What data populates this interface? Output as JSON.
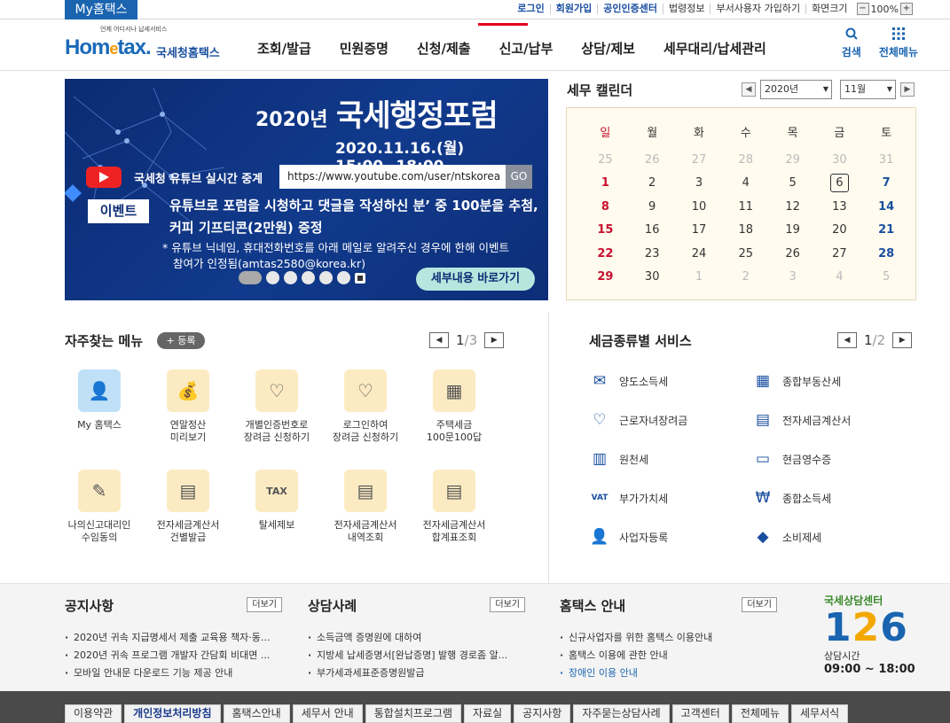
{
  "topbar": {
    "my_hometax": "My홈택스",
    "links": [
      {
        "label": "로그인",
        "style": "blue"
      },
      {
        "label": "회원가입",
        "style": "blue"
      },
      {
        "label": "공인인증센터",
        "style": "blue"
      },
      {
        "label": "법령정보",
        "style": "normal"
      },
      {
        "label": "부서사용자 가입하기",
        "style": "normal"
      },
      {
        "label": "화면크기",
        "style": "normal"
      }
    ],
    "zoom_minus": "−",
    "zoom_value": "100%",
    "zoom_plus": "+"
  },
  "header": {
    "logo_tiny": "언제 어디서나 납세서비스",
    "logo_home": "Hom",
    "logo_e": "e",
    "logo_tax": "tax.",
    "logo_kor": "국세청홈택스",
    "gnb": [
      "조회/발급",
      "민원증명",
      "신청/제출",
      "신고/납부",
      "상담/제보",
      "세무대리/납세관리"
    ],
    "search_label": "검색",
    "allmenu_label": "전체메뉴"
  },
  "banner": {
    "year": "2020년",
    "title": "국세행정포럼",
    "datetime": "2020.11.16.(월) 15:00~18:00",
    "live_text": "국세청 유튜브 실시간 중계",
    "url": "https://www.youtube.com/user/ntskorea",
    "go": "GO",
    "event_badge": "이벤트",
    "line1": "유튜브로 포럼을 시청하고 댓글을 작성하신 분’ 중 100분을 추첨,",
    "line2": "커피 기프티콘(2만원) 증정",
    "note1": "* 유튜브 닉네임, 휴대전화번호를 아래 메일로 알려주신 경우에 한해 이벤트",
    "note2": "참여가 인정됨(amtas2580@korea.kr)",
    "cta": "세부내용 바로가기"
  },
  "calendar": {
    "title": "세무 캘린더",
    "year_select": "2020년",
    "month_select": "11월",
    "weekdays": [
      "일",
      "월",
      "화",
      "수",
      "목",
      "금",
      "토"
    ],
    "weeks": [
      [
        "25",
        "26",
        "27",
        "28",
        "29",
        "30",
        "31"
      ],
      [
        "1",
        "2",
        "3",
        "4",
        "5",
        "6",
        "7"
      ],
      [
        "8",
        "9",
        "10",
        "11",
        "12",
        "13",
        "14"
      ],
      [
        "15",
        "16",
        "17",
        "18",
        "19",
        "20",
        "21"
      ],
      [
        "22",
        "23",
        "24",
        "25",
        "26",
        "27",
        "28"
      ],
      [
        "29",
        "30",
        "1",
        "2",
        "3",
        "4",
        "5"
      ]
    ],
    "today": "6"
  },
  "favorites": {
    "title": "자주찾는 메뉴",
    "register": "+ 등록",
    "page_current": "1",
    "page_total": "/3",
    "items": [
      {
        "label": "My 홈택스",
        "icon": "user-icon",
        "glyph": "👤"
      },
      {
        "label": "연말정산\n미리보기",
        "icon": "money-bag-icon",
        "glyph": "💰"
      },
      {
        "label": "개별인증번호로\n장려금 신청하기",
        "icon": "heart-hand-icon",
        "glyph": "♡"
      },
      {
        "label": "로그인하여\n장려금 신청하기",
        "icon": "heart-pen-icon",
        "glyph": "♡"
      },
      {
        "label": "주택세금\n100문100답",
        "icon": "building-icon",
        "glyph": "▦"
      },
      {
        "label": "나의신고대리인\n수임동의",
        "icon": "document-pen-icon",
        "glyph": "✎"
      },
      {
        "label": "전자세금계산서\n건별발급",
        "icon": "calculator-icon",
        "glyph": "▤"
      },
      {
        "label": "탈세제보",
        "icon": "tax-bag-icon",
        "glyph": "TAX"
      },
      {
        "label": "전자세금계산서\n내역조회",
        "icon": "search-doc-icon",
        "glyph": "▤"
      },
      {
        "label": "전자세금계산서\n합계표조회",
        "icon": "calc-doc-icon",
        "glyph": "▤"
      }
    ]
  },
  "tax_services": {
    "title": "세금종류별 서비스",
    "page_current": "1",
    "page_total": "/2",
    "items": [
      {
        "label": "양도소득세",
        "icon": "transfer-doc-icon",
        "glyph": "✉"
      },
      {
        "label": "종합부동산세",
        "icon": "real-estate-icon",
        "glyph": "▦"
      },
      {
        "label": "근로자녀장려금",
        "icon": "heart-icon",
        "glyph": "♡"
      },
      {
        "label": "전자세금계산서",
        "icon": "invoice-icon",
        "glyph": "▤"
      },
      {
        "label": "원천세",
        "icon": "salary-icon",
        "glyph": "▥"
      },
      {
        "label": "현금영수증",
        "icon": "cash-receipt-icon",
        "glyph": "▭"
      },
      {
        "label": "부가가치세",
        "icon": "vat-icon",
        "glyph": "VAT"
      },
      {
        "label": "종합소득세",
        "icon": "income-bag-icon",
        "glyph": "₩"
      },
      {
        "label": "사업자등록",
        "icon": "person-icon",
        "glyph": "👤"
      },
      {
        "label": "소비제세",
        "icon": "diamond-icon",
        "glyph": "◆"
      }
    ]
  },
  "boards": [
    {
      "title": "공지사항",
      "more": "더보기",
      "items": [
        {
          "text": "2020년 귀속 지급명세서 제출 교육용 책자·동...",
          "blue": false
        },
        {
          "text": "2020년 귀속 프로그램 개발자 간담회 비대면 ...",
          "blue": false
        },
        {
          "text": "모바일 안내문 다운로드 기능 제공 안내",
          "blue": false
        }
      ]
    },
    {
      "title": "상담사례",
      "more": "더보기",
      "items": [
        {
          "text": "소득금액 증명원에 대하여",
          "blue": false
        },
        {
          "text": "지방세 납세증명서[완납증명] 발행 경로좀 알...",
          "blue": false
        },
        {
          "text": "부가세과세표준증명원발급",
          "blue": false
        }
      ]
    },
    {
      "title": "홈택스 안내",
      "more": "더보기",
      "items": [
        {
          "text": "신규사업자를 위한 홈택스 이용안내",
          "blue": false
        },
        {
          "text": "홈택스 이용에 관한 안내",
          "blue": false
        },
        {
          "text": "장애인 이용 안내",
          "blue": true
        }
      ]
    }
  ],
  "center": {
    "label": "국세상담센터",
    "number_a": "1",
    "number_b": "2",
    "number_c": "6",
    "hours_label": "상담시간",
    "hours": "09:00 ~ 18:00"
  },
  "footer": {
    "links": [
      {
        "label": "이용약관",
        "bold": false
      },
      {
        "label": "개인정보처리방침",
        "bold": true
      },
      {
        "label": "홈택스안내",
        "bold": false
      },
      {
        "label": "세무서 안내",
        "bold": false
      },
      {
        "label": "통합설치프로그램",
        "bold": false
      },
      {
        "label": "자료실",
        "bold": false
      },
      {
        "label": "공지사항",
        "bold": false
      },
      {
        "label": "자주묻는상담사례",
        "bold": false
      },
      {
        "label": "고객센터",
        "bold": false
      },
      {
        "label": "전체메뉴",
        "bold": false
      },
      {
        "label": "세무서식",
        "bold": false
      }
    ]
  }
}
